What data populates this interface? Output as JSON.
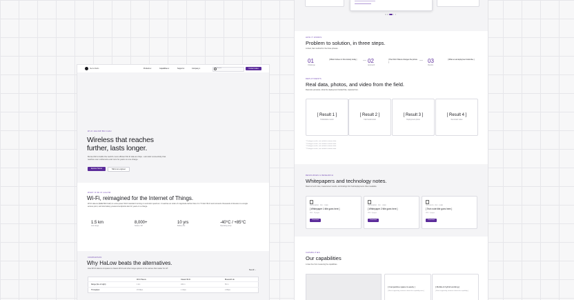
{
  "nav": {
    "brand": "Sierra Radio",
    "items": [
      "Products",
      "Capabilities",
      "Support",
      "Company"
    ],
    "search_placeholder": "Search",
    "cta": "Contact sales"
  },
  "hero": {
    "eyebrow": "WI-FI HALOW 802.11AH",
    "title_line1": "Wireless that reaches",
    "title_line2": "further, lasts longer.",
    "body": "Morse Micro builds the world's most efficient Wi-Fi HaLow chips - sub-GHz connectivity that reaches over a kilometre and runs for years on one charge.",
    "primary": "Explore HaLow",
    "secondary": "Talk to an engineer"
  },
  "intro": {
    "eyebrow": "WHAT IS WI-FI HALOW",
    "title": "Wi-Fi, reimagined for the Internet of Things.",
    "body": "Wi-Fi HaLow (IEEE 802.11ah) is a low-power Wi-Fi standard running on sub-GHz spectrum. It reaches an order of magnitude farther than 2.4 / 5 GHz Wi-Fi and connects thousands of devices to a single access point, and lets battery-powered endpoints last for years on a charge."
  },
  "stats": [
    {
      "value": "1.5 km",
      "label": "Link range"
    },
    {
      "value": "8,000+",
      "label": "Nodes / AP"
    },
    {
      "value": "10 yrs",
      "label": "Battery life"
    },
    {
      "value": "-40°C / +85°C",
      "label": "Operating temp"
    }
  ],
  "compare": {
    "eyebrow": "COMPARISON",
    "title": "Why HaLow beats the alternatives.",
    "body": "How Wi-Fi HaLow compares to classic Wi-Fi and other range options in the various that matter for IoT.",
    "link": "See all →",
    "columns": [
      "",
      "Wi-Fi HaLow",
      "Classic Wi-Fi",
      "Bluetooth LE"
    ],
    "rows": [
      [
        "Range (line of sight)",
        "1 km",
        "100 m",
        "50 m"
      ],
      [
        "Throughput",
        "15 Mbps",
        "1 Gbps",
        "2 Mbps"
      ]
    ]
  },
  "carousel_dots": 5,
  "solution": {
    "eyebrow": "HOW IT WORKS",
    "title": "Problem to solution, in three steps.",
    "subtitle": "A clear, fast method for the three phases.",
    "steps": [
      {
        "num": "01",
        "tag": "Challenge",
        "text": "[ What's broken in this industry today ]"
      },
      {
        "num": "02",
        "tag": "Approach",
        "text": "[ How Wi-Fi HaLow changes the picture ]"
      },
      {
        "num": "03",
        "tag": "Results",
        "text": "[ What a real deployment looks like ]"
      }
    ]
  },
  "field": {
    "eyebrow": "DEPLOYMENTS",
    "title": "Real data, photos, and video from the field.",
    "subtitle": "Real-site previews, what the deployment looked like, captured live.",
    "results": [
      {
        "title": "[ Result 1 ]",
        "sub": "Publishable metric"
      },
      {
        "title": "[ Result 2 ]",
        "sub": "Field testimonial"
      },
      {
        "title": "[ Result 3 ]",
        "sub": "Deployment photo"
      },
      {
        "title": "[ Result 4 ]",
        "sub": "Recorded video"
      }
    ],
    "notes": [
      "* Prototype results, not verified customer data",
      "* Prototype results, not verified customer data",
      "* Prototype results, not verified customer data",
      "* Prototype results, not verified customer data"
    ]
  },
  "papers": {
    "eyebrow": "RESOURCES & RESEARCH",
    "title": "Whitepapers and technology notes.",
    "subtitle": "Read our tech notes, measurement results, and briefings from field deployments. Direct available.",
    "items": [
      {
        "meta": "WHITEPAPER · PDF · 2.4MB",
        "title": "[ Whitepaper 1 title goes here ]",
        "sub": "PDF · 12 pages",
        "cta": "Download"
      },
      {
        "meta": "WHITEPAPER · PDF · 1.8MB",
        "title": "[ Whitepaper 2 title goes here ]",
        "sub": "PDF · 8 pages",
        "cta": "Download"
      },
      {
        "meta": "TECH NOTE · PDF · 0.9MB",
        "title": "[ Tech note title goes here ]",
        "sub": "PDF · 4 pages",
        "cta": "Download"
      }
    ]
  },
  "capabilities": {
    "eyebrow": "CAPABILITIES",
    "title": "Our capabilities",
    "subtitle": "A clear line from measuring the capabilities.",
    "cards": [
      {
        "title": "[ Competitive space & equity ]",
        "sub": "[ Short supporting sentence about this capability area ]"
      },
      {
        "title": "[ Mobile & hybrid working ]",
        "sub": "[ Short supporting sentence about this capability ]"
      }
    ]
  },
  "colors": {
    "accent": "#5b2b9a"
  }
}
